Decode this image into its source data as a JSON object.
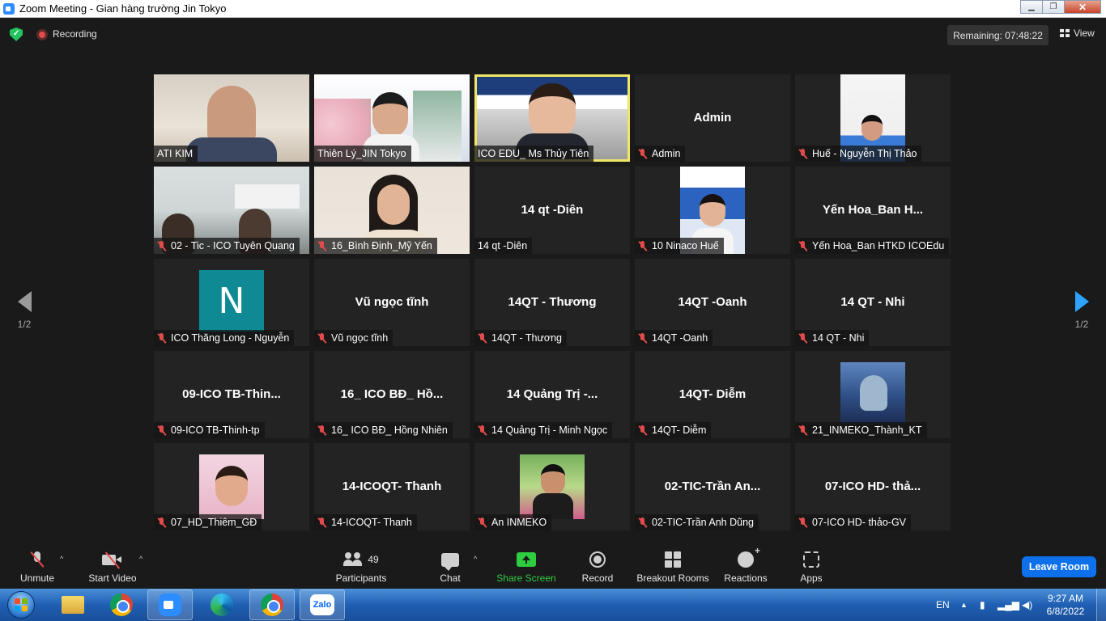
{
  "window": {
    "title": "Zoom Meeting - Gian hàng trường Jin Tokyo",
    "min": "▁",
    "max": "❐",
    "close": "✕"
  },
  "topbar": {
    "recording": "Recording",
    "remaining": "Remaining: 07:48:22",
    "view": "View"
  },
  "nav": {
    "page_left": "1/2",
    "page_right": "1/2"
  },
  "tiles": [
    {
      "label": "ATI KIM",
      "muted": false,
      "video": "office"
    },
    {
      "label": "Thiên Lý_JIN Tokyo",
      "muted": false,
      "video": "slide"
    },
    {
      "label": "ICO EDU_ Ms Thủy Tiên",
      "muted": false,
      "video": "ico",
      "active": true
    },
    {
      "center": "Admin",
      "label": "Admin",
      "muted": true
    },
    {
      "label": "Huế - Nguyễn Thị Thảo",
      "muted": true,
      "video": "hue"
    },
    {
      "label": "02 - Tic - ICO Tuyên Quang",
      "muted": true,
      "video": "class"
    },
    {
      "label": "16_Bình Định_Mỹ Yến",
      "muted": true,
      "video": "girl"
    },
    {
      "center": "14 qt -Diên",
      "label": "14 qt -Diên",
      "muted": false
    },
    {
      "label": "10 Ninaco Huế",
      "muted": true,
      "video": "ninaco"
    },
    {
      "center": "Yến Hoa_Ban H...",
      "label": "Yến Hoa_Ban HTKD ICOEdu",
      "muted": true
    },
    {
      "label": "ICO Thăng Long - Nguyễn",
      "muted": true,
      "avatar": "N"
    },
    {
      "center": "Vũ ngọc tĩnh",
      "label": "Vũ ngọc tĩnh",
      "muted": true
    },
    {
      "center": "14QT - Thương",
      "label": "14QT - Thương",
      "muted": true
    },
    {
      "center": "14QT -Oanh",
      "label": "14QT -Oanh",
      "muted": true
    },
    {
      "center": "14 QT - Nhi",
      "label": "14 QT - Nhi",
      "muted": true
    },
    {
      "center": "09-ICO TB-Thin...",
      "label": "09-ICO TB-Thinh-tp",
      "muted": true
    },
    {
      "center": "16_ ICO BĐ_ Hồ...",
      "label": "16_ ICO BĐ_ Hồng Nhiên",
      "muted": true
    },
    {
      "center": "14 Quảng Trị -...",
      "label": "14 Quảng Trị - Minh Ngọc",
      "muted": true
    },
    {
      "center": "14QT- Diễm",
      "label": "14QT- Diễm",
      "muted": true
    },
    {
      "label": "21_INMEKO_Thành_KT",
      "muted": true,
      "video": "anime"
    },
    {
      "label": "07_HD_Thiêm_GĐ",
      "muted": true,
      "video": "photo1"
    },
    {
      "center": "14-ICOQT- Thanh",
      "label": "14-ICOQT- Thanh",
      "muted": true
    },
    {
      "label": "An INMEKO",
      "muted": true,
      "video": "photo2"
    },
    {
      "center": "02-TIC-Trần An...",
      "label": "02-TIC-Trần Anh Dũng",
      "muted": true
    },
    {
      "center": "07-ICO HD- thả...",
      "label": "07-ICO HD- thảo-GV",
      "muted": true
    }
  ],
  "toolbar": {
    "unmute": "Unmute",
    "start_video": "Start Video",
    "participants": "Participants",
    "participants_count": "49",
    "chat": "Chat",
    "share_screen": "Share Screen",
    "record": "Record",
    "breakout_rooms": "Breakout Rooms",
    "reactions": "Reactions",
    "apps": "Apps",
    "leave": "Leave Room"
  },
  "taskbar": {
    "zalo": "Zalo",
    "lang": "EN",
    "time": "9:27 AM",
    "date": "6/8/2022"
  }
}
